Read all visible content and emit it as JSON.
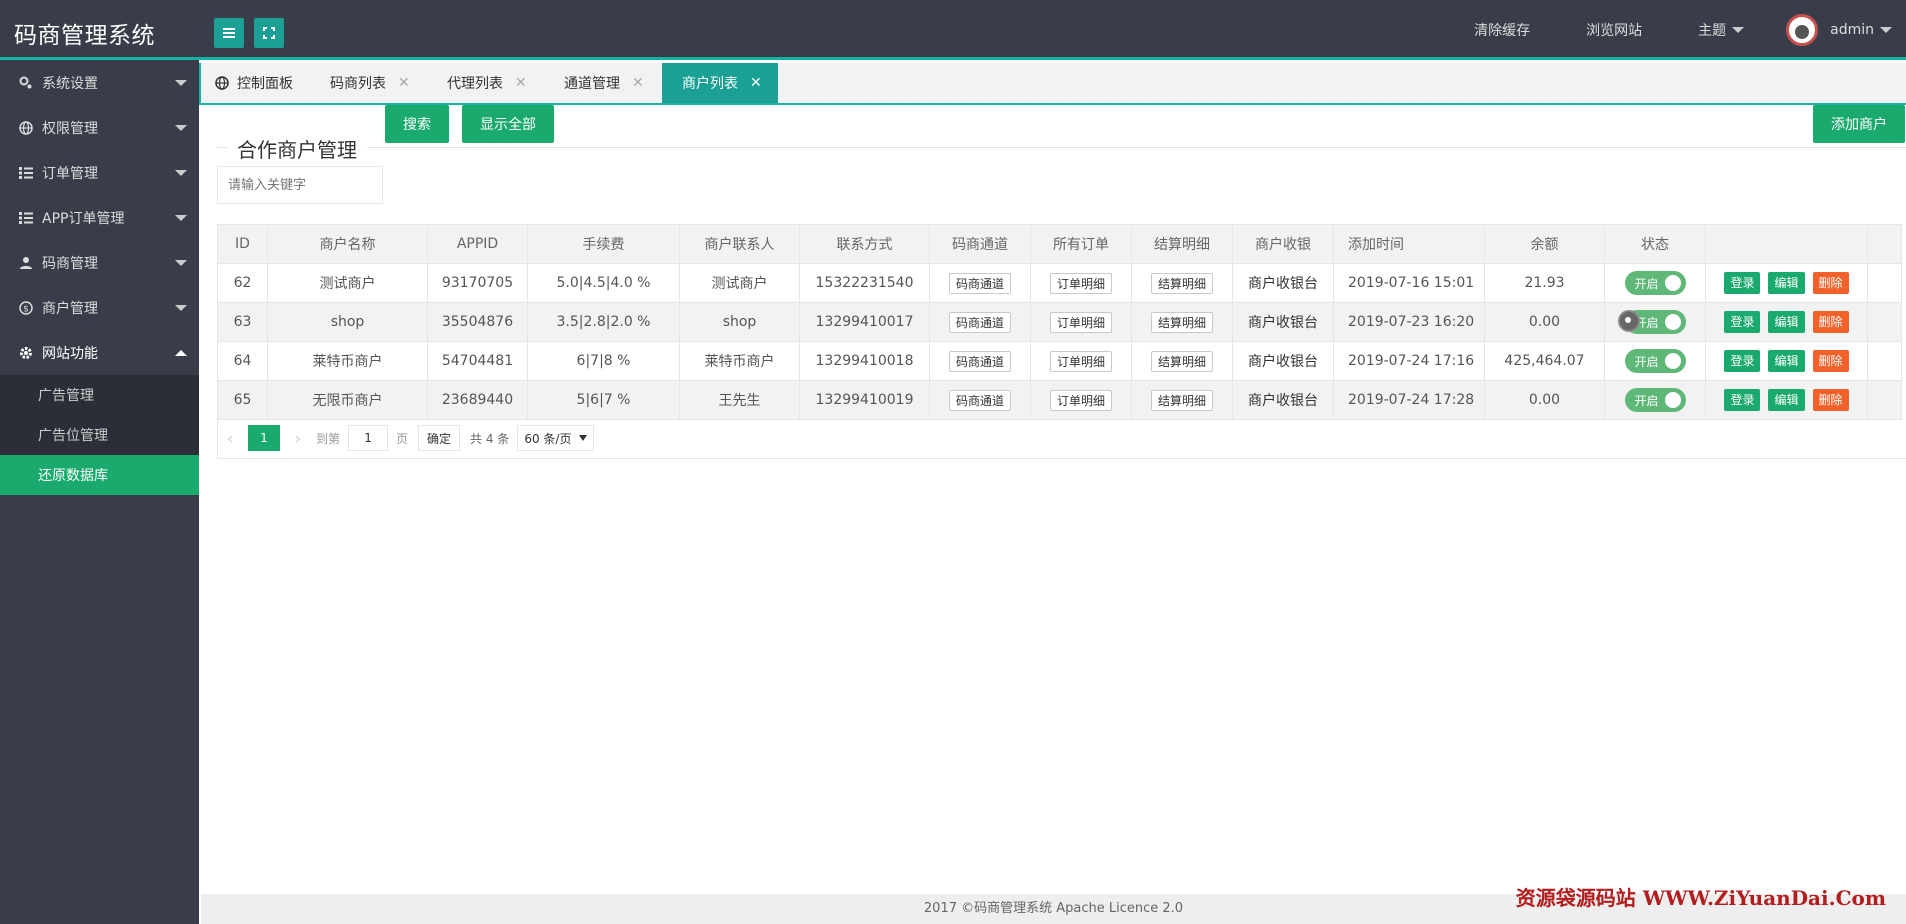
{
  "app": {
    "title": "码商管理系统"
  },
  "header": {
    "links": [
      "清除缓存",
      "浏览网站"
    ],
    "theme_label": "主题",
    "username": "admin"
  },
  "sidebar": {
    "items": [
      {
        "label": "系统设置",
        "icon": "gear-icon"
      },
      {
        "label": "权限管理",
        "icon": "globe-icon"
      },
      {
        "label": "订单管理",
        "icon": "list-icon"
      },
      {
        "label": "APP订单管理",
        "icon": "list-icon"
      },
      {
        "label": "码商管理",
        "icon": "user-icon"
      },
      {
        "label": "商户管理",
        "icon": "coin-icon"
      },
      {
        "label": "网站功能",
        "icon": "cog-icon"
      }
    ],
    "submenu": [
      "广告管理",
      "广告位管理",
      "还原数据库"
    ]
  },
  "tabs": [
    {
      "label": "控制面板",
      "icon": "globe-icon"
    },
    {
      "label": "码商列表"
    },
    {
      "label": "代理列表"
    },
    {
      "label": "通道管理"
    },
    {
      "label": "商户列表"
    }
  ],
  "close_glyph": "✕",
  "page": {
    "title": "合作商户管理",
    "search_placeholder": "请输入关键字",
    "search_button": "搜索",
    "show_all_button": "显示全部",
    "add_button": "添加商户"
  },
  "table": {
    "headers": [
      "ID",
      "商户名称",
      "APPID",
      "手续费",
      "商户联系人",
      "联系方式",
      "码商通道",
      "所有订单",
      "结算明细",
      "商户收银",
      "添加时间",
      "余额",
      "状态",
      "",
      ""
    ],
    "rows": [
      {
        "id": "62",
        "name": "测试商户",
        "appid": "93170705",
        "fee": "5.0|4.5|4.0 %",
        "contact": "测试商户",
        "phone": "15322231540",
        "channel": "码商通道",
        "orders": "订单明细",
        "settle": "结算明细",
        "cashier": "商户收银台",
        "time": "2019-07-16 15:01",
        "balance": "21.93",
        "status": "开启"
      },
      {
        "id": "63",
        "name": "shop",
        "appid": "35504876",
        "fee": "3.5|2.8|2.0 %",
        "contact": "shop",
        "phone": "13299410017",
        "channel": "码商通道",
        "orders": "订单明细",
        "settle": "结算明细",
        "cashier": "商户收银台",
        "time": "2019-07-23 16:20",
        "balance": "0.00",
        "status": "开启"
      },
      {
        "id": "64",
        "name": "莱特币商户",
        "appid": "54704481",
        "fee": "6|7|8 %",
        "contact": "莱特币商户",
        "phone": "13299410018",
        "channel": "码商通道",
        "orders": "订单明细",
        "settle": "结算明细",
        "cashier": "商户收银台",
        "time": "2019-07-24 17:16",
        "balance": "425,464.07",
        "status": "开启"
      },
      {
        "id": "65",
        "name": "无限币商户",
        "appid": "23689440",
        "fee": "5|6|7 %",
        "contact": "王先生",
        "phone": "13299410019",
        "channel": "码商通道",
        "orders": "订单明细",
        "settle": "结算明细",
        "cashier": "商户收银台",
        "time": "2019-07-24 17:28",
        "balance": "0.00",
        "status": "开启"
      }
    ],
    "actions": {
      "login": "登录",
      "edit": "编辑",
      "delete": "删除"
    }
  },
  "pager": {
    "prev": "‹",
    "next": "›",
    "current": "1",
    "goto_label": "到第",
    "goto_value": "1",
    "page_unit": "页",
    "confirm": "确定",
    "total": "共 4 条",
    "page_size": "60 条/页"
  },
  "footer": {
    "text": "2017 ©码商管理系统 Apache Licence 2.0"
  },
  "watermark": "资源袋源码站  WWW.ZiYuanDai.Com",
  "colors": {
    "sidebar_bg": "#393d49",
    "accent": "#1aaa6e",
    "tab_active": "#1aa094",
    "danger": "#f0622a"
  }
}
